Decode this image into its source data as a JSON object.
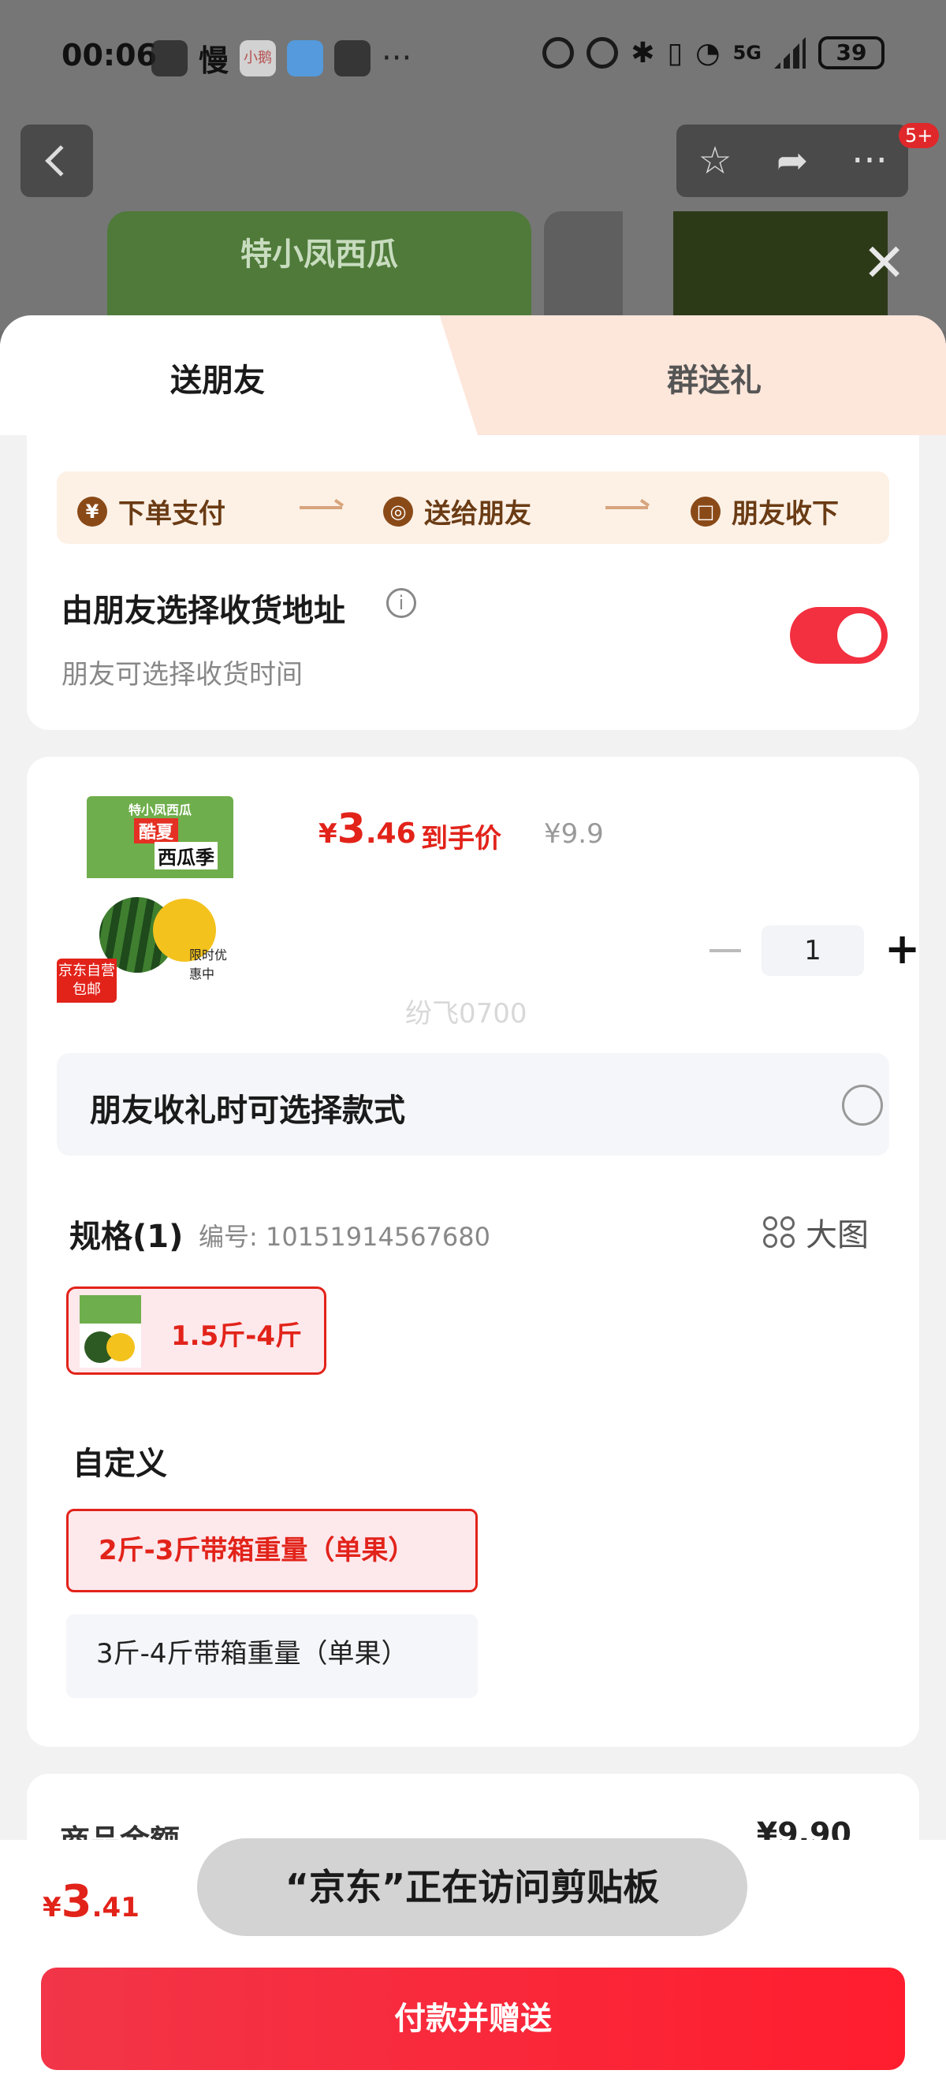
{
  "status_bar": {
    "time": "00:06",
    "app_slow": "慢",
    "app_label": "小鹅",
    "more": "···",
    "network": "5G",
    "battery": "39"
  },
  "top_nav": {
    "badge": "5+"
  },
  "banner": {
    "title": "特小凤西瓜"
  },
  "tabs": [
    {
      "label": "送朋友",
      "active": true
    },
    {
      "label": "群送礼",
      "active": false
    }
  ],
  "steps": [
    {
      "icon": "¥",
      "label": "下单支付"
    },
    {
      "icon": "◎",
      "label": "送给朋友"
    },
    {
      "icon": "□",
      "label": "朋友收下"
    }
  ],
  "address": {
    "title": "由朋友选择收货地址",
    "subtitle": "朋友可选择收货时间",
    "toggle_on": true
  },
  "product": {
    "thumb_title": "特小凤西瓜",
    "thumb_cool": "酷夏",
    "thumb_season": "西瓜季",
    "thumb_promo": "限时优惠中",
    "jd_tag": "京东自营包邮",
    "price_currency": "¥",
    "price_int": "3",
    "price_dec": ".46",
    "price_label": "到手价",
    "original_price": "¥9.9",
    "quantity": "1",
    "watermark": "纷飞0700"
  },
  "choose_style": {
    "label": "朋友收礼时可选择款式",
    "checked": false
  },
  "spec": {
    "title": "规格(1)",
    "code": "编号: 10151914567680",
    "big_pic_label": "大图",
    "chip_label": "1.5斤-4斤"
  },
  "custom": {
    "title": "自定义",
    "options": [
      {
        "label": "2斤-3斤带箱重量（单果）",
        "selected": true
      },
      {
        "label": "3斤-4斤带箱重量（单果）",
        "selected": false
      }
    ]
  },
  "summary": {
    "label": "商品金额",
    "value": "¥9.90"
  },
  "bottom": {
    "price_currency": "¥",
    "price_int": "3",
    "price_dec": ".41",
    "pay_button": "付款并赠送"
  },
  "toast": "“京东”正在访问剪贴板",
  "colors": {
    "accent": "#e2231a",
    "toggle": "#f23040",
    "step_text": "#6a3b14"
  }
}
